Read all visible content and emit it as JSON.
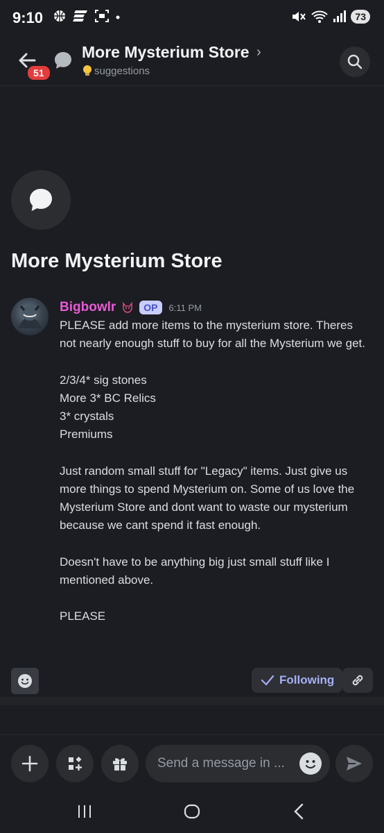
{
  "status_bar": {
    "time": "9:10",
    "battery": "73",
    "icons_left": [
      "basketball-icon",
      "espn-icon",
      "screenshot-icon",
      "dot-icon"
    ],
    "icons_right": [
      "mute-icon",
      "wifi-icon",
      "signal-icon"
    ]
  },
  "header": {
    "title": "More Mysterium Store",
    "chevron": "›",
    "channel": "suggestions",
    "unread_badge": "51"
  },
  "thread": {
    "title": "More Mysterium Store"
  },
  "message": {
    "author": "Bigbowlr",
    "op_badge": "OP",
    "timestamp": "6:11 PM",
    "lines": [
      "PLEASE add more items to the mysterium store. Theres not nearly enough stuff to buy for all the Mysterium we get.",
      "",
      "2/3/4* sig stones",
      "More 3* BC Relics",
      "3* crystals",
      "Premiums",
      "",
      "Just random small stuff for \"Legacy\" items. Just give us more things to spend Mysterium on. Some of us love the Mysterium Store and dont want to waste our mysterium because we cant spend it fast enough.",
      "",
      "Doesn't have to be anything big just small stuff like I mentioned above.",
      "",
      "PLEASE"
    ]
  },
  "actions": {
    "following_label": "Following"
  },
  "composer": {
    "placeholder": "Send a message in ..."
  },
  "colors": {
    "background": "#1c1d22",
    "username": "#e85bd6",
    "accent": "#a6b0f5",
    "badge_red": "#e23c3c"
  }
}
